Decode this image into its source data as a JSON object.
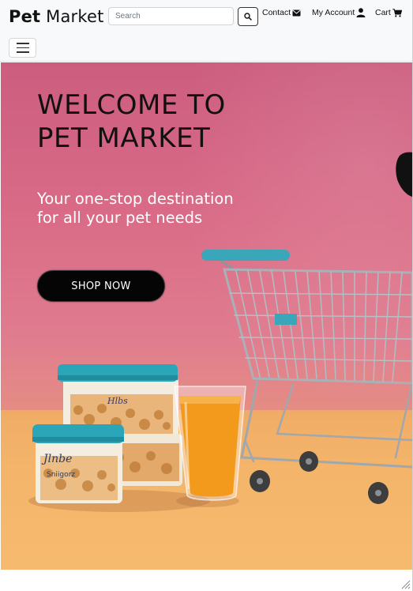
{
  "header": {
    "brand_bold": "Pet",
    "brand_rest": " Market",
    "search_placeholder": "Search",
    "nav": {
      "contact": "Contact",
      "account": "My Account",
      "cart": "Cart"
    }
  },
  "hero": {
    "title": "WELCOME TO PET MARKET",
    "subtitle": "Your one-stop destination for all your pet needs",
    "cta": "SHOP NOW"
  },
  "icons": {
    "search": "search-icon",
    "contact": "envelope-icon",
    "account": "user-icon",
    "cart": "cart-icon",
    "menu": "hamburger-icon"
  },
  "colors": {
    "hero_pink": "#d96b87",
    "hero_floor": "#f4b56a",
    "container_teal": "#2aa6b8",
    "juice": "#f39a1c",
    "button_bg": "#050505"
  }
}
